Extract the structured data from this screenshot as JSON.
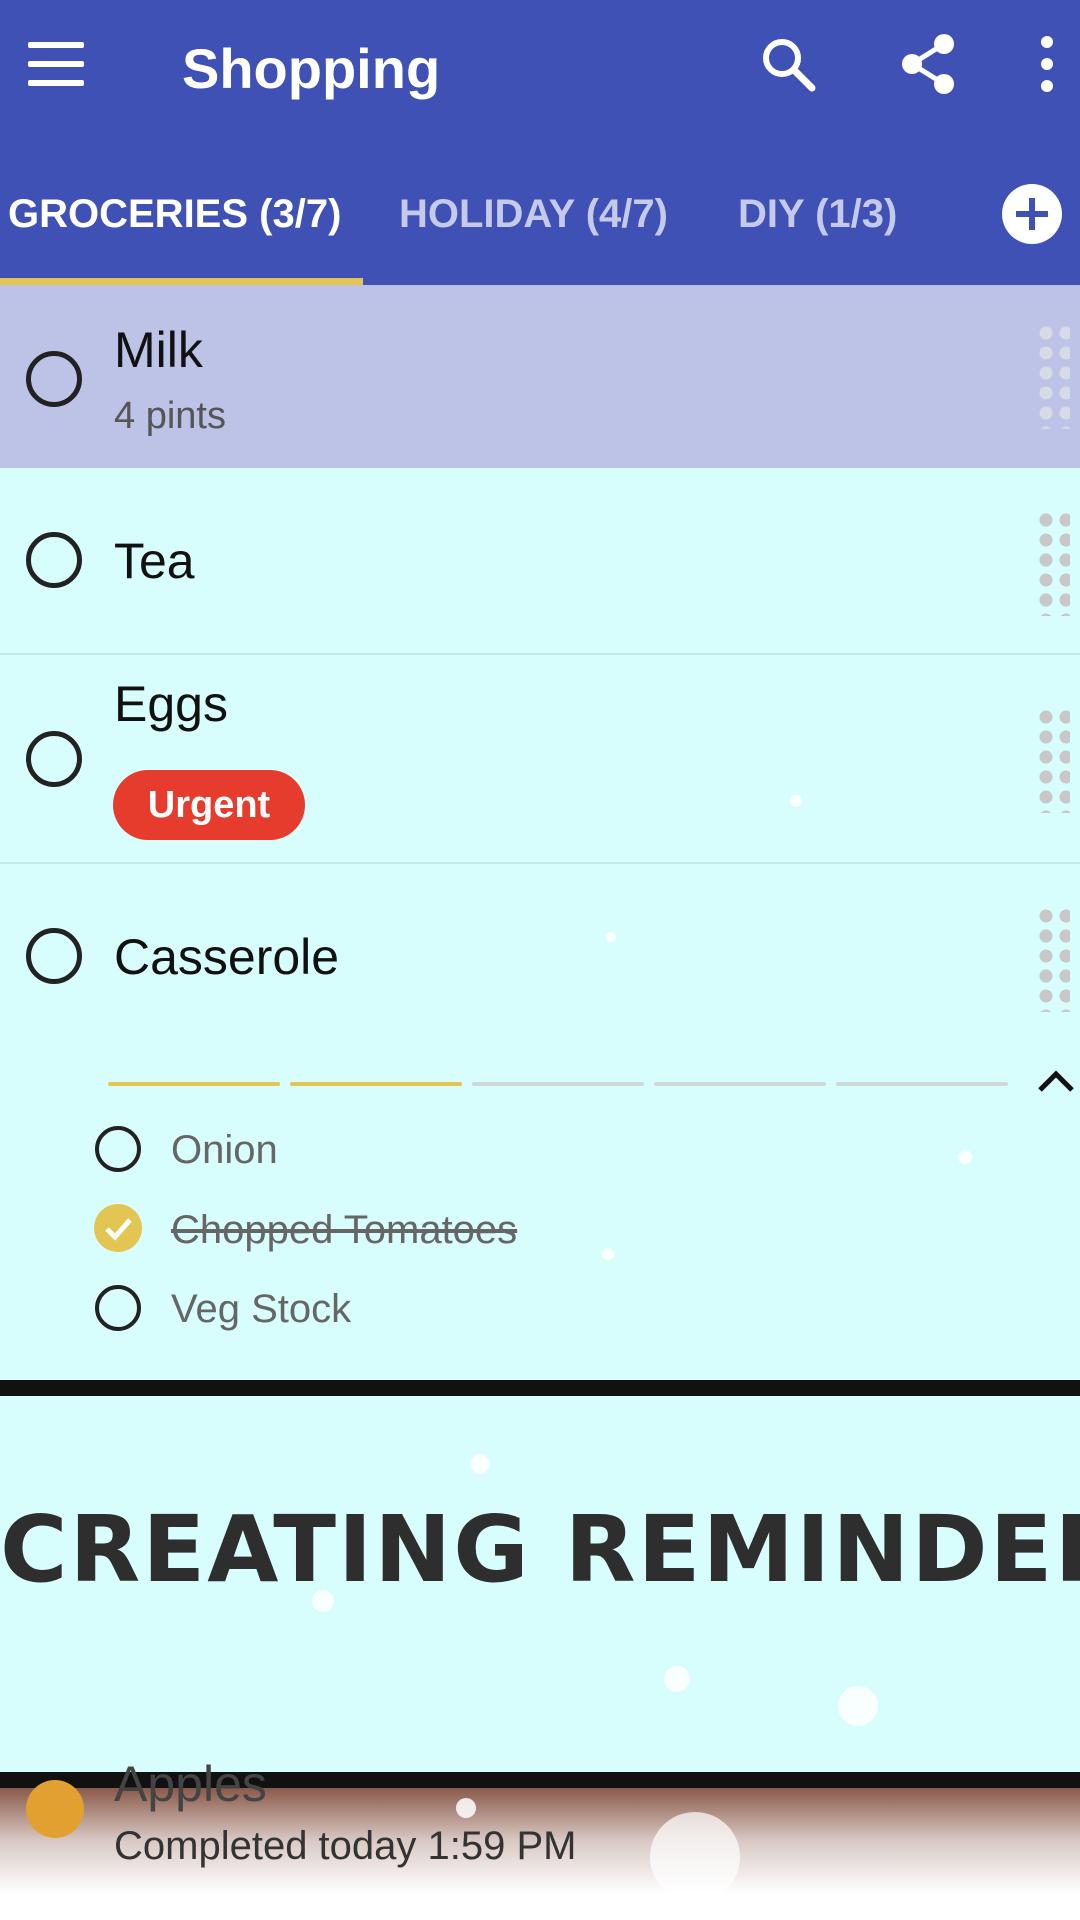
{
  "appbar": {
    "title": "Shopping",
    "icons": [
      "menu-icon",
      "search-icon",
      "share-icon",
      "more-vert-icon"
    ],
    "color": "#3f51b5"
  },
  "tabs": [
    {
      "label": "GROCERIES (3/7)",
      "active": true
    },
    {
      "label": "HOLIDAY (4/7)",
      "active": false
    },
    {
      "label": "DIY (1/3)",
      "active": false
    }
  ],
  "items": [
    {
      "title": "Milk",
      "subtitle": "4 pints",
      "highlighted": true
    },
    {
      "title": "Tea"
    },
    {
      "title": "Eggs",
      "badge": "Urgent"
    },
    {
      "title": "Casserole",
      "expanded": true
    }
  ],
  "casserole": {
    "progress_segments_done": 2,
    "progress_segments_total": 5,
    "subitems": [
      {
        "label": "Onion",
        "checked": false
      },
      {
        "label": "Chopped Tomatoes",
        "checked": true
      },
      {
        "label": "Veg Stock",
        "checked": false
      }
    ]
  },
  "overlay": {
    "caption": "CREATING REMINDER"
  },
  "completed_item": {
    "title": "Apples",
    "subtitle": "Completed today 1:59 PM"
  },
  "colors": {
    "accent": "#e2c552",
    "urgent": "#e53c2d",
    "background": "#d8fdfd",
    "highlight_row": "#bcc3e6"
  }
}
